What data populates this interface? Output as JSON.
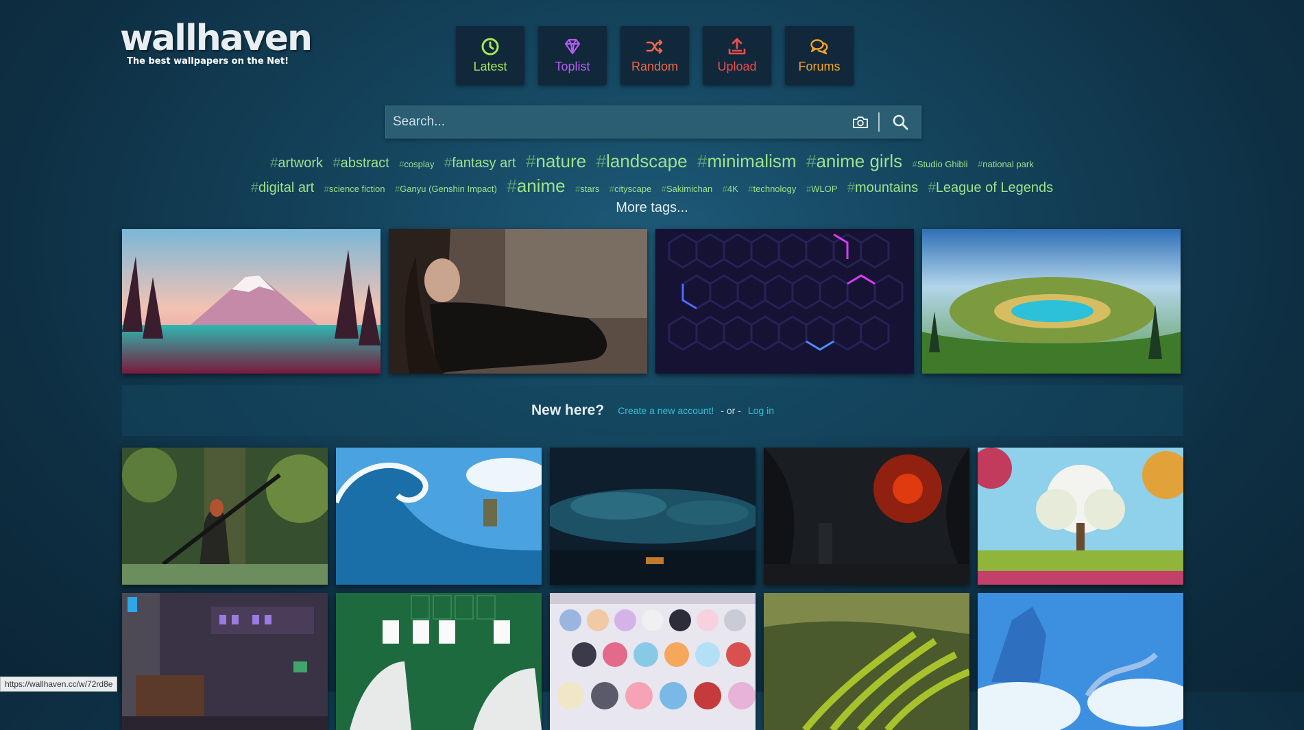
{
  "logo": {
    "title": "wallhaven",
    "tagline": "The best wallpapers on the Net!"
  },
  "nav": [
    {
      "label": "Latest",
      "icon": "clock-icon",
      "color": "#a5e75b"
    },
    {
      "label": "Toplist",
      "icon": "diamond-icon",
      "color": "#b35cf2"
    },
    {
      "label": "Random",
      "icon": "shuffle-icon",
      "color": "#f3664a"
    },
    {
      "label": "Upload",
      "icon": "upload-icon",
      "color": "#ee4d4d"
    },
    {
      "label": "Forums",
      "icon": "chat-icon",
      "color": "#f5a623"
    }
  ],
  "search": {
    "placeholder": "Search..."
  },
  "tags": {
    "row1": [
      {
        "name": "artwork",
        "size": 2
      },
      {
        "name": "abstract",
        "size": 2
      },
      {
        "name": "cosplay",
        "size": 1
      },
      {
        "name": "fantasy art",
        "size": 2
      },
      {
        "name": "nature",
        "size": 3
      },
      {
        "name": "landscape",
        "size": 3
      },
      {
        "name": "minimalism",
        "size": 3
      },
      {
        "name": "anime girls",
        "size": 3
      },
      {
        "name": "Studio Ghibli",
        "size": 1
      },
      {
        "name": "national park",
        "size": 1
      }
    ],
    "row2": [
      {
        "name": "digital art",
        "size": 2
      },
      {
        "name": "science fiction",
        "size": 1
      },
      {
        "name": "Ganyu (Genshin Impact)",
        "size": 1
      },
      {
        "name": "anime",
        "size": 3
      },
      {
        "name": "stars",
        "size": 1
      },
      {
        "name": "cityscape",
        "size": 1
      },
      {
        "name": "Sakimichan",
        "size": 1
      },
      {
        "name": "4K",
        "size": 1
      },
      {
        "name": "technology",
        "size": 1
      },
      {
        "name": "WLOP",
        "size": 1
      },
      {
        "name": "mountains",
        "size": 2
      },
      {
        "name": "League of Legends",
        "size": 2
      }
    ],
    "more": "More tags..."
  },
  "featured": [
    {
      "subject": "mountain-landscape"
    },
    {
      "subject": "woman-portrait"
    },
    {
      "subject": "neon-hexagons"
    },
    {
      "subject": "crater-lake"
    }
  ],
  "signup": {
    "prompt": "New here?",
    "create_link": "Create a new account!",
    "or": "- or -",
    "login_link": "Log in"
  },
  "thumbs": [
    {
      "subject": "forest-swordswoman"
    },
    {
      "subject": "great-wave"
    },
    {
      "subject": "dark-clouds"
    },
    {
      "subject": "red-planet"
    },
    {
      "subject": "white-tree"
    },
    {
      "subject": "pixel-city"
    },
    {
      "subject": "solitaire"
    },
    {
      "subject": "anime-group"
    },
    {
      "subject": "rice-terraces"
    },
    {
      "subject": "sky-dragon"
    }
  ],
  "status_url": "https://wallhaven.cc/w/72rd8e"
}
